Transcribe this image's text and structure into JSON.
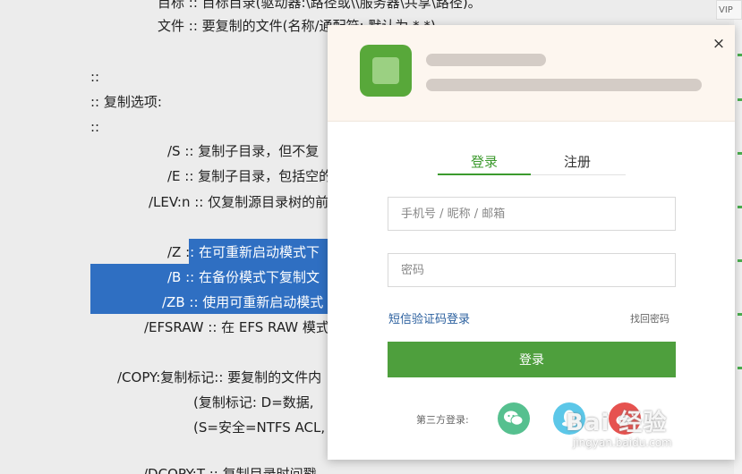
{
  "document": {
    "lines": [
      "目标 :: 目标目录(驱动器:\\路径或\\\\服务器\\共享\\路径)。",
      "文件 :: 要复制的文件(名称/通配符: 默认为 *.*)。",
      "::",
      ":: 复制选项:",
      "::",
      "/S :: 复制子目录，但不复",
      "/E :: 复制子目录，包括空的",
      "/LEV:n :: 仅复制源目录树的前",
      "/Z :: 在可重新启动模式下",
      "/B :: 在备份模式下复制文",
      "/ZB :: 使用可重新启动模式",
      "/EFSRAW :: 在 EFS RAW 模式",
      "/COPY:复制标记:: 要复制的文件内",
      "(复制标记: D=数据,",
      "(S=安全=NTFS ACL,",
      "/DCOPY:T :: 复制目录时间戳"
    ]
  },
  "side": {
    "vip_label": "VIP"
  },
  "modal": {
    "close_symbol": "×",
    "tabs": [
      {
        "label": "登录",
        "active": true
      },
      {
        "label": "注册",
        "active": false
      }
    ],
    "account_placeholder": "手机号 / 昵称 / 邮箱",
    "password_placeholder": "密码",
    "sms_login_label": "短信验证码登录",
    "forgot_label": "找回密码",
    "login_button_label": "登录",
    "third_party_label": "第三方登录:",
    "social_icons": [
      "wechat-icon",
      "qq-icon",
      "weibo-icon"
    ]
  },
  "watermark": {
    "brand": "Bai 经验",
    "url": "jingyan.baidu.com"
  },
  "colors": {
    "accent": "#4e9f3d",
    "tab_active": "#3c9a2e",
    "highlight": "#2f6fc2",
    "link": "#2a5f9e"
  }
}
